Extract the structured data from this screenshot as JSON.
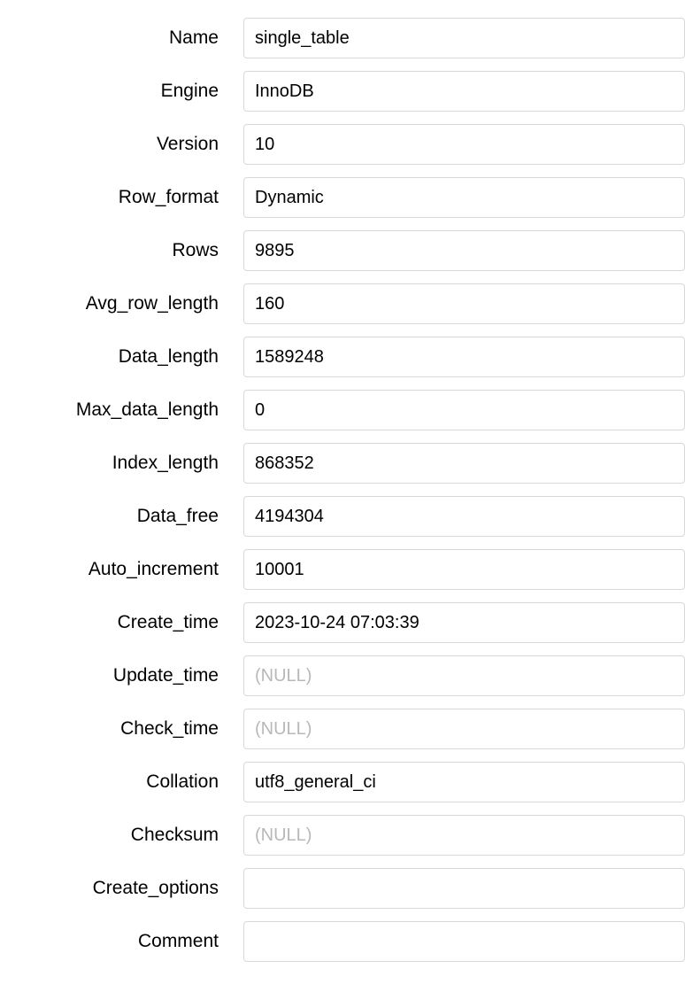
{
  "fields": {
    "name": {
      "label": "Name",
      "value": "single_table",
      "null": false
    },
    "engine": {
      "label": "Engine",
      "value": "InnoDB",
      "null": false
    },
    "version": {
      "label": "Version",
      "value": "10",
      "null": false
    },
    "row_format": {
      "label": "Row_format",
      "value": "Dynamic",
      "null": false
    },
    "rows": {
      "label": "Rows",
      "value": "9895",
      "null": false
    },
    "avg_row_length": {
      "label": "Avg_row_length",
      "value": "160",
      "null": false
    },
    "data_length": {
      "label": "Data_length",
      "value": "1589248",
      "null": false
    },
    "max_data_length": {
      "label": "Max_data_length",
      "value": "0",
      "null": false
    },
    "index_length": {
      "label": "Index_length",
      "value": "868352",
      "null": false
    },
    "data_free": {
      "label": "Data_free",
      "value": "4194304",
      "null": false
    },
    "auto_increment": {
      "label": "Auto_increment",
      "value": "10001",
      "null": false
    },
    "create_time": {
      "label": "Create_time",
      "value": "2023-10-24 07:03:39",
      "null": false
    },
    "update_time": {
      "label": "Update_time",
      "value": "(NULL)",
      "null": true
    },
    "check_time": {
      "label": "Check_time",
      "value": "(NULL)",
      "null": true
    },
    "collation": {
      "label": "Collation",
      "value": "utf8_general_ci",
      "null": false
    },
    "checksum": {
      "label": "Checksum",
      "value": "(NULL)",
      "null": true
    },
    "create_options": {
      "label": "Create_options",
      "value": "",
      "null": false
    },
    "comment": {
      "label": "Comment",
      "value": "",
      "null": false
    }
  }
}
